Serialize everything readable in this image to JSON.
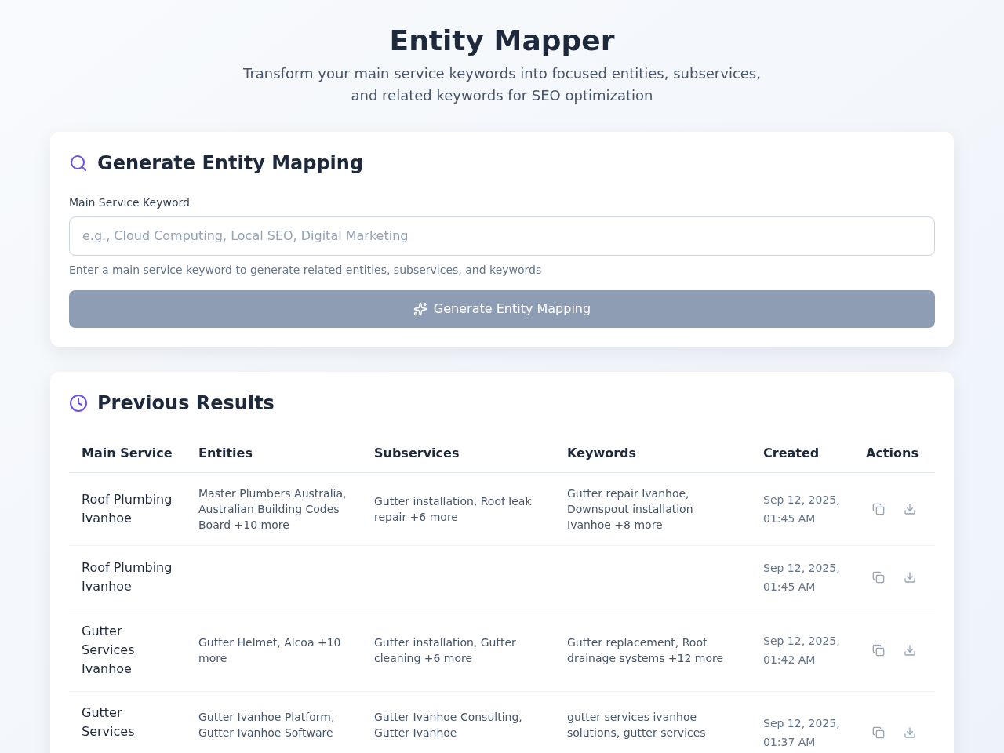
{
  "header": {
    "title": "Entity Mapper",
    "subtitle": "Transform your main service keywords into focused entities, subservices, and related keywords for SEO optimization"
  },
  "generate_card": {
    "title": "Generate Entity Mapping",
    "field": {
      "label": "Main Service Keyword",
      "placeholder": "e.g., Cloud Computing, Local SEO, Digital Marketing",
      "hint": "Enter a main service keyword to generate related entities, subservices, and keywords"
    },
    "button": {
      "label": "Generate Entity Mapping",
      "disabled": true
    }
  },
  "results_card": {
    "title": "Previous Results",
    "table": {
      "columns": [
        "Main Service",
        "Entities",
        "Subservices",
        "Keywords",
        "Created",
        "Actions"
      ],
      "rows": [
        {
          "main_service": "Roof Plumbing Ivanhoe",
          "entities": "Master Plumbers Australia, Australian Building Codes Board +10 more",
          "subservices": "Gutter installation, Roof leak repair +6 more",
          "keywords": "Gutter repair Ivanhoe, Downspout installation Ivanhoe +8 more",
          "created": "Sep 12, 2025, 01:45 AM"
        },
        {
          "main_service": "Roof Plumbing Ivanhoe",
          "created": "Sep 12, 2025, 01:45 AM"
        },
        {
          "main_service": "Gutter Services Ivanhoe",
          "entities": "Gutter Helmet, Alcoa +10 more",
          "subservices": "Gutter installation, Gutter cleaning +6 more",
          "keywords": "Gutter replacement, Roof drainage systems +12 more",
          "created": "Sep 12, 2025, 01:42 AM"
        },
        {
          "main_service": "Gutter Services",
          "entities": "Gutter Ivanhoe Platform, Gutter Ivanhoe Software",
          "subservices": "Gutter Ivanhoe Consulting, Gutter Ivanhoe",
          "keywords": "gutter services ivanhoe solutions, gutter services",
          "created": "Sep 12, 2025, 01:37 AM"
        }
      ]
    }
  }
}
